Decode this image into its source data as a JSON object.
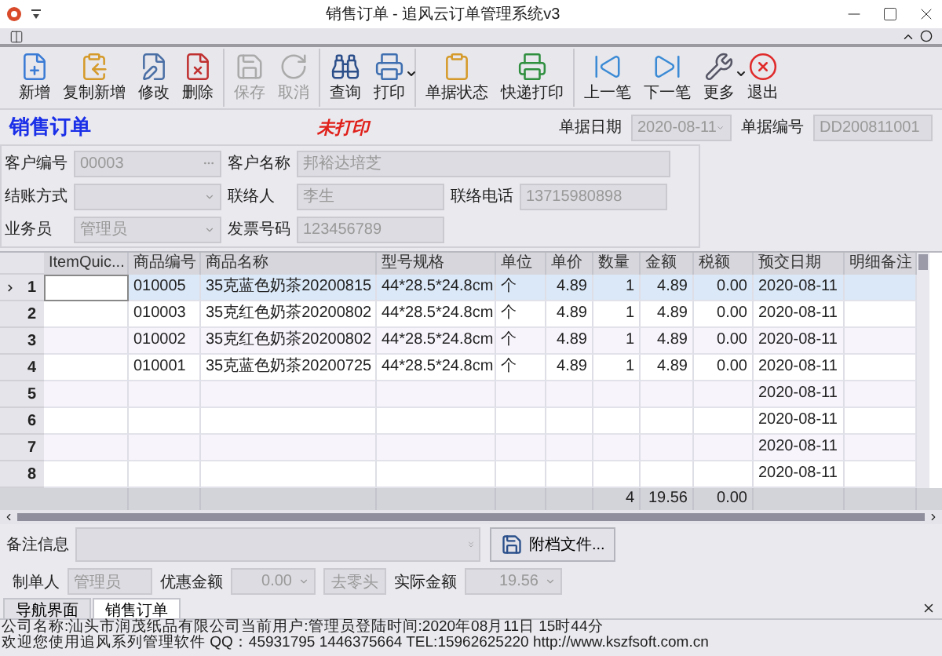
{
  "window": {
    "title": "销售订单 - 追风云订单管理系统v3"
  },
  "toolbar": {
    "groups": [
      [
        {
          "label": "新增",
          "disabled": false,
          "has_menu": false
        },
        {
          "label": "复制新增",
          "disabled": false,
          "has_menu": false
        },
        {
          "label": "修改",
          "disabled": false,
          "has_menu": false
        },
        {
          "label": "删除",
          "disabled": false,
          "has_menu": false
        }
      ],
      [
        {
          "label": "保存",
          "disabled": true,
          "has_menu": false
        },
        {
          "label": "取消",
          "disabled": true,
          "has_menu": false
        }
      ],
      [
        {
          "label": "查询",
          "disabled": false,
          "has_menu": false
        },
        {
          "label": "打印",
          "disabled": false,
          "has_menu": true
        }
      ],
      [
        {
          "label": "单据状态",
          "disabled": false,
          "has_menu": false
        },
        {
          "label": "快递打印",
          "disabled": false,
          "has_menu": false
        }
      ],
      [
        {
          "label": "上一笔",
          "disabled": false,
          "has_menu": false
        },
        {
          "label": "下一笔",
          "disabled": false,
          "has_menu": false
        },
        {
          "label": "更多",
          "disabled": false,
          "has_menu": true
        },
        {
          "label": "退出",
          "disabled": false,
          "has_menu": false
        }
      ]
    ]
  },
  "header": {
    "title": "销售订单",
    "print_status": "未打印",
    "date": {
      "label": "单据日期",
      "value": "2020-08-11"
    },
    "number": {
      "label": "单据编号",
      "value": "DD200811001"
    }
  },
  "form": {
    "rows": [
      [
        {
          "label": "客户编号",
          "value": "00003",
          "kind": "ellipsis"
        },
        {
          "label": "客户名称",
          "value": "邦裕达培芝",
          "kind": "wide"
        }
      ],
      [
        {
          "label": "结账方式",
          "kind": "dropdown"
        },
        {
          "label": "联络人",
          "value": "李生",
          "kind": "text"
        },
        {
          "label": "联络电话",
          "value": "13715980898",
          "kind": "text"
        }
      ],
      [
        {
          "label": "业务员",
          "value": "管理员",
          "kind": "dropdown"
        },
        {
          "label": "发票号码",
          "value": "123456789",
          "kind": "text"
        }
      ]
    ]
  },
  "grid": {
    "columns": [
      "ItemQuic...",
      "商品编号",
      "商品名称",
      "型号规格",
      "单位",
      "单价",
      "数量",
      "金额",
      "税额",
      "预交日期",
      "明细备注"
    ],
    "rows": [
      {
        "number": "1",
        "selected": true,
        "cells": [
          "",
          "010005",
          "35克蓝色奶茶20200815",
          "44*28.5*24.8cm",
          "个",
          "4.89",
          "1",
          "4.89",
          "0.00",
          "2020-08-11",
          ""
        ]
      },
      {
        "number": "2",
        "selected": false,
        "cells": [
          "",
          "010003",
          "35克红色奶茶20200802",
          "44*28.5*24.8cm",
          "个",
          "4.89",
          "1",
          "4.89",
          "0.00",
          "2020-08-11",
          ""
        ]
      },
      {
        "number": "3",
        "selected": false,
        "cells": [
          "",
          "010002",
          "35克红色奶茶20200802",
          "44*28.5*24.8cm",
          "个",
          "4.89",
          "1",
          "4.89",
          "0.00",
          "2020-08-11",
          ""
        ]
      },
      {
        "number": "4",
        "selected": false,
        "cells": [
          "",
          "010001",
          "35克蓝色奶茶20200725",
          "44*28.5*24.8cm",
          "个",
          "4.89",
          "1",
          "4.89",
          "0.00",
          "2020-08-11",
          ""
        ]
      },
      {
        "number": "5",
        "selected": false,
        "cells": [
          "",
          "",
          "",
          "",
          "",
          "",
          "",
          "",
          "",
          "2020-08-11",
          ""
        ]
      },
      {
        "number": "6",
        "selected": false,
        "cells": [
          "",
          "",
          "",
          "",
          "",
          "",
          "",
          "",
          "",
          "2020-08-11",
          ""
        ]
      },
      {
        "number": "7",
        "selected": false,
        "cells": [
          "",
          "",
          "",
          "",
          "",
          "",
          "",
          "",
          "",
          "2020-08-11",
          ""
        ]
      },
      {
        "number": "8",
        "selected": false,
        "cells": [
          "",
          "",
          "",
          "",
          "",
          "",
          "",
          "",
          "",
          "2020-08-11",
          ""
        ]
      }
    ],
    "totals": {
      "quantity": "4",
      "amount": "19.56",
      "tax": "0.00"
    }
  },
  "remarks": {
    "label": "备注信息",
    "attach_button": "附档文件..."
  },
  "summary": {
    "maker": {
      "label": "制单人",
      "value": "管理员"
    },
    "discount": {
      "label": "优惠金额",
      "value": "0.00"
    },
    "round_button": "去零头",
    "actual": {
      "label": "实际金额",
      "value": "19.56"
    }
  },
  "tabs": [
    {
      "label": "导航界面",
      "selected": false
    },
    {
      "label": "销售订单",
      "selected": true
    }
  ],
  "status_bar": [
    "公司名称:汕头市润茂纸品有限公司当前用户:管理员登陆时间:2020年08月11日 15时44分",
    "欢迎您使用追风系列管理软件 QQ：45931795 1446375664 TEL:15962625220 http://www.kszfsoft.com.cn"
  ]
}
